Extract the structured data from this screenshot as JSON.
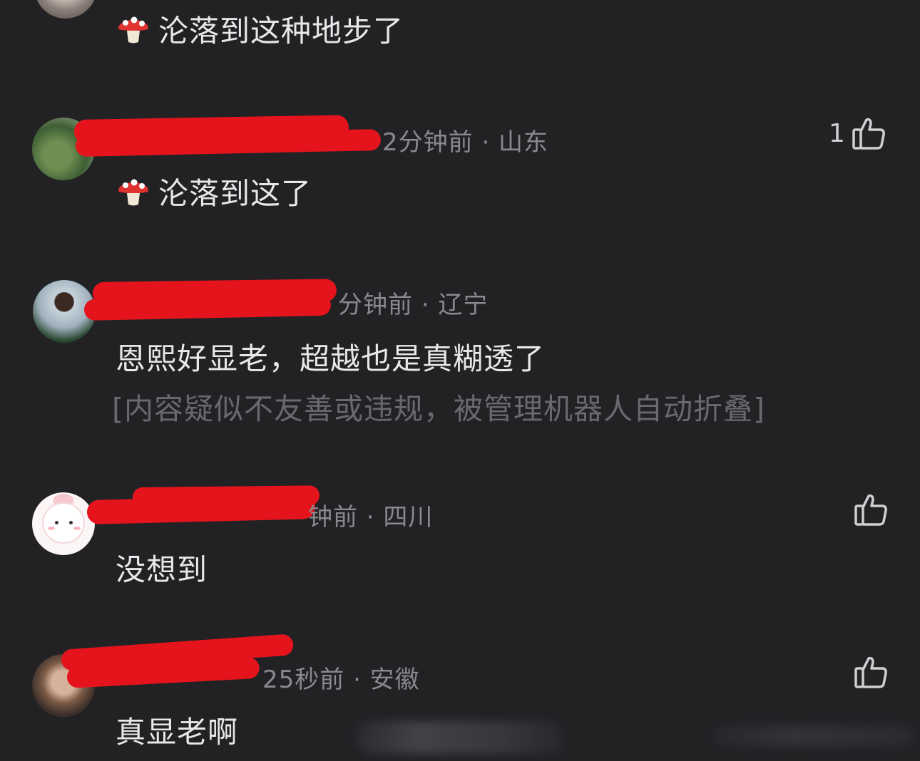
{
  "comments": [
    {
      "avatar_icon": "avatar-photo",
      "content": "沦落到这种地步了",
      "has_mushroom": true
    },
    {
      "avatar_icon": "avatar-photo-trees",
      "meta": "2分钟前 · 山东",
      "content": "沦落到这了",
      "has_mushroom": true,
      "like_count": "1"
    },
    {
      "avatar_icon": "avatar-photo-woman",
      "meta": "分钟前 · 辽宁",
      "content": "恩熙好显老，超越也是真糊透了",
      "folded_notice": "[内容疑似不友善或违规，被管理机器人自动折叠]"
    },
    {
      "avatar_icon": "avatar-cartoon",
      "meta": "钟前 · 四川",
      "content": "没想到",
      "like_count": ""
    },
    {
      "avatar_icon": "avatar-photo-portrait",
      "meta": "25秒前 · 安徽",
      "content": "真显老啊",
      "like_count": ""
    }
  ],
  "colors": {
    "background": "#222225",
    "redaction": "#e5141c",
    "meta_text": "#8a8a8e",
    "content_text": "#e8e8ea",
    "folded_text": "#6a6a6e"
  }
}
